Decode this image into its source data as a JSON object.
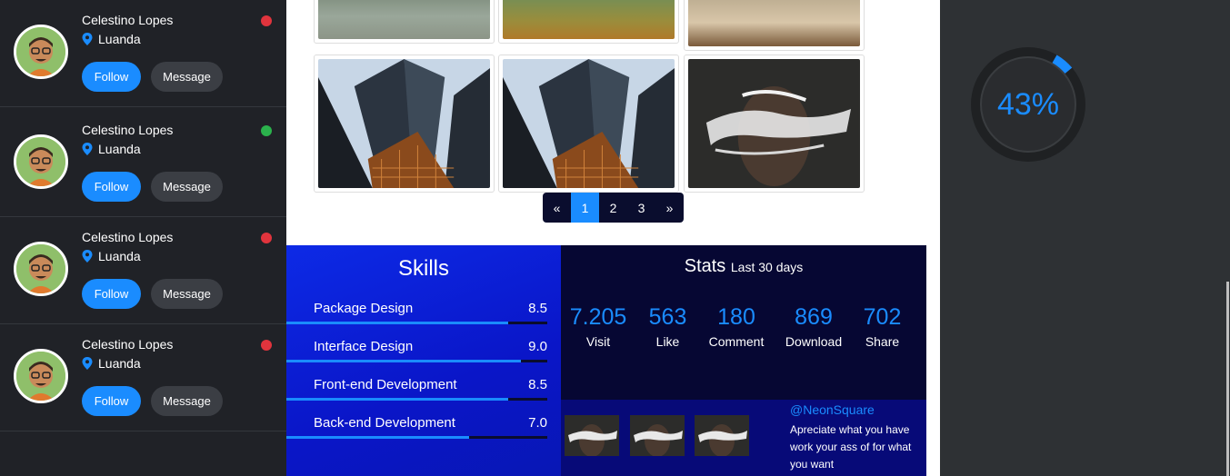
{
  "users": [
    {
      "name": "Celestino Lopes",
      "location": "Luanda",
      "status_color": "#e0343d",
      "follow_label": "Follow",
      "message_label": "Message"
    },
    {
      "name": "Celestino Lopes",
      "location": "Luanda",
      "status_color": "#2bb24c",
      "follow_label": "Follow",
      "message_label": "Message"
    },
    {
      "name": "Celestino Lopes",
      "location": "Luanda",
      "status_color": "#e0343d",
      "follow_label": "Follow",
      "message_label": "Message"
    },
    {
      "name": "Celestino Lopes",
      "location": "Luanda",
      "status_color": "#e0343d",
      "follow_label": "Follow",
      "message_label": "Message"
    }
  ],
  "gallery": {
    "images": [
      "runner-legs-photo",
      "runner-grass-photo",
      "woman-window-photo",
      "skyscrapers-photo",
      "skyscrapers-photo",
      "paint-face-photo"
    ]
  },
  "pagination": {
    "prev": "«",
    "pages": [
      "1",
      "2",
      "3"
    ],
    "active": "1",
    "next": "»"
  },
  "skills": {
    "title": "Skills",
    "items": [
      {
        "name": "Package Design",
        "value": "8.5",
        "level": 0.85
      },
      {
        "name": "Interface Design",
        "value": "9.0",
        "level": 0.9
      },
      {
        "name": "Front-end Development",
        "value": "8.5",
        "level": 0.85
      },
      {
        "name": "Back-end Development",
        "value": "7.0",
        "level": 0.7
      }
    ]
  },
  "stats": {
    "title": "Stats",
    "subtitle": "Last 30 days",
    "items": [
      {
        "value": "7.205",
        "label": "Visit"
      },
      {
        "value": "563",
        "label": "Like"
      },
      {
        "value": "180",
        "label": "Comment"
      },
      {
        "value": "869",
        "label": "Download"
      },
      {
        "value": "702",
        "label": "Share"
      }
    ]
  },
  "tweet": {
    "handle": "@NeonSquare",
    "text": "Apreciate what you have work your ass of for what you want"
  },
  "gauge": {
    "label": "43%",
    "value": 0.43
  },
  "colors": {
    "accent": "#1a8cff",
    "sidebar_bg": "#202227",
    "skills_bg": "#0d2ae6",
    "stats_bg": "#060733",
    "panel_bg": "#2e3134"
  }
}
